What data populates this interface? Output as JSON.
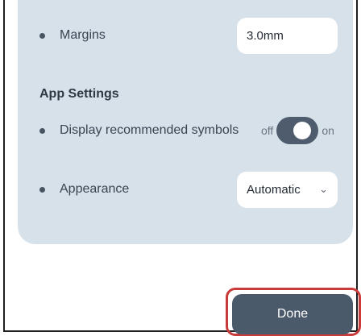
{
  "settings": {
    "margins": {
      "label": "Margins",
      "value": "3.0mm"
    },
    "app_settings_title": "App Settings",
    "symbols": {
      "label": "Display recommended symbols",
      "off": "off",
      "on": "on",
      "state": "on"
    },
    "appearance": {
      "label": "Appearance",
      "value": "Automatic"
    }
  },
  "actions": {
    "done_label": "Done"
  },
  "colors": {
    "panel": "#d7e1ea",
    "button": "#4b5a6b",
    "highlight": "#c93a3a"
  },
  "icons": {
    "bullet": "dot-icon",
    "dropdown": "chevron-down-icon"
  }
}
